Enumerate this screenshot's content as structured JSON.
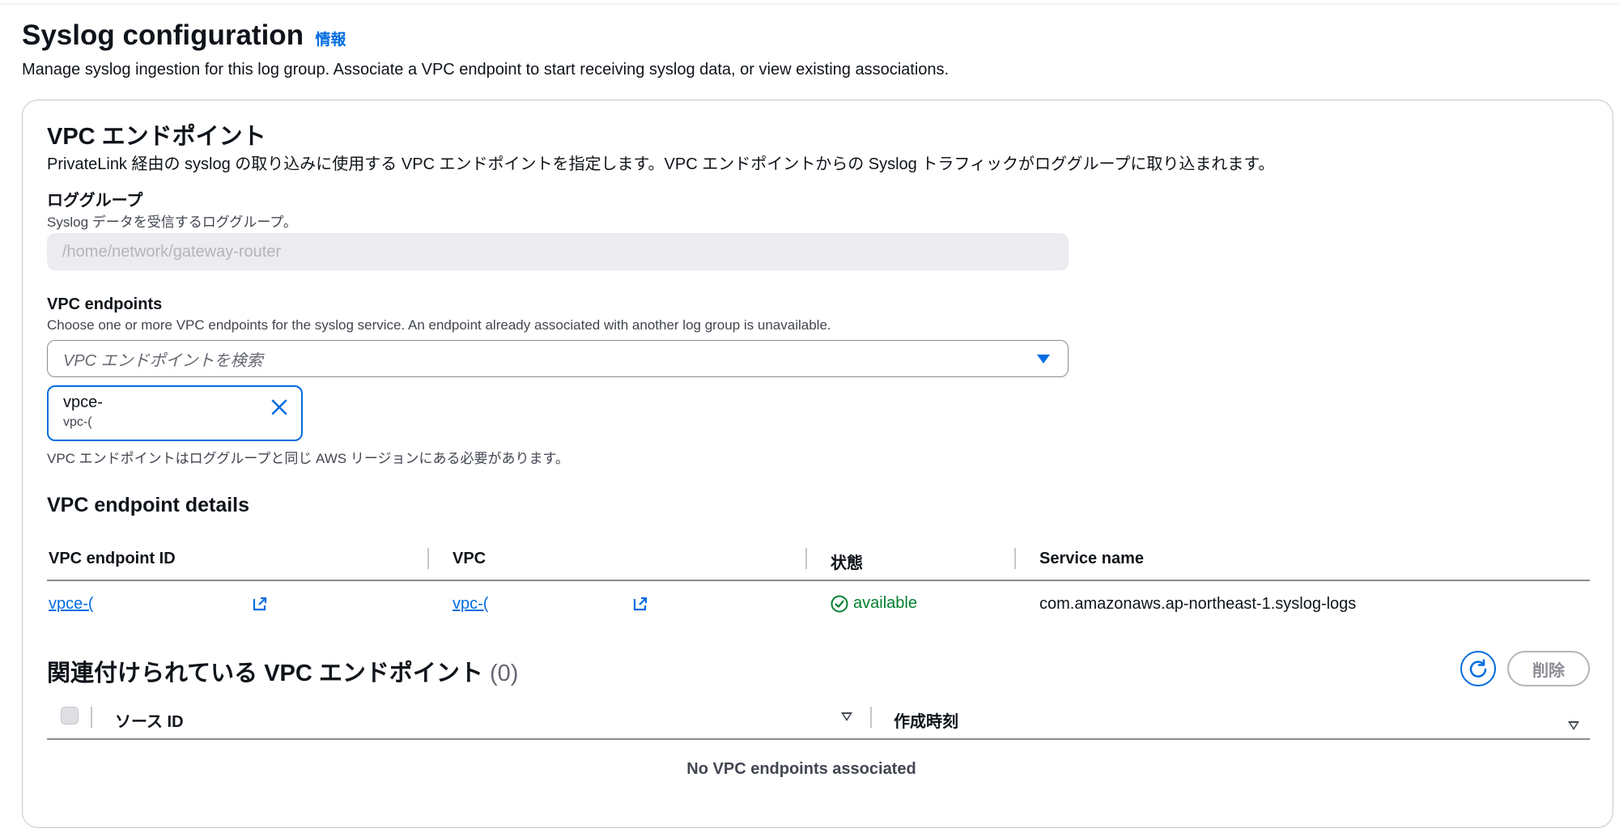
{
  "page": {
    "title": "Syslog configuration",
    "info_link": "情報",
    "description": "Manage syslog ingestion for this log group. Associate a VPC endpoint to start receiving syslog data, or view existing associations."
  },
  "vpc_section": {
    "title": "VPC エンドポイント",
    "description": "PrivateLink 経由の syslog の取り込みに使用する VPC エンドポイントを指定します。VPC エンドポイントからの Syslog トラフィックがロググループに取り込まれます。"
  },
  "log_group": {
    "label": "ロググループ",
    "description": "Syslog データを受信するロググループ。",
    "value": "/home/network/gateway-router"
  },
  "vpc_endpoints": {
    "label": "VPC endpoints",
    "description": "Choose one or more VPC endpoints for the syslog service. An endpoint already associated with another log group is unavailable.",
    "placeholder": "VPC エンドポイントを検索",
    "token_title": "vpce-",
    "token_sub": "vpc-(",
    "hint": "VPC エンドポイントはロググループと同じ AWS リージョンにある必要があります。"
  },
  "details": {
    "title": "VPC endpoint details",
    "columns": [
      "VPC endpoint ID",
      "VPC",
      "状態",
      "Service name"
    ],
    "row": {
      "endpoint_id": "vpce-(",
      "vpc": "vpc-(",
      "status": "available",
      "service_name": "com.amazonaws.ap-northeast-1.syslog-logs"
    }
  },
  "associated": {
    "title": "関連付けられている VPC エンドポイント",
    "count": "(0)",
    "delete_label": "削除",
    "columns": [
      "ソース ID",
      "作成時刻"
    ],
    "empty": "No VPC endpoints associated"
  },
  "colors": {
    "accent": "#006ce0",
    "success": "#00802f",
    "border": "#c6c6cd"
  },
  "icons": [
    "chevron-down-icon",
    "close-icon",
    "external-link-icon",
    "status-check-icon",
    "refresh-icon",
    "sort-icon"
  ]
}
